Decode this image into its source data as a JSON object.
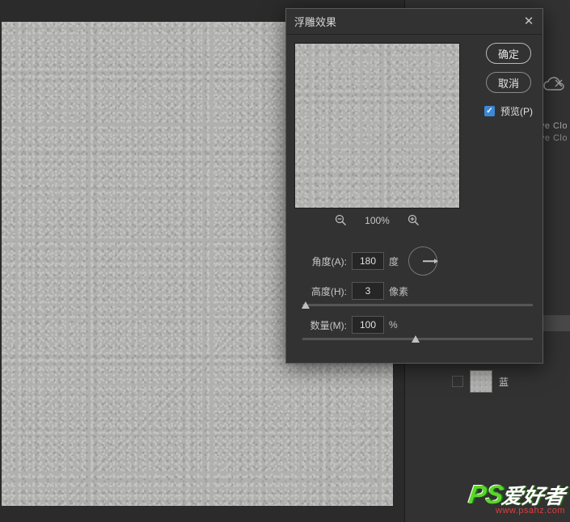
{
  "dialog": {
    "title": "浮雕效果",
    "ok_label": "确定",
    "cancel_label": "取消",
    "preview_label": "预览(P)",
    "preview_checked": true,
    "zoom_value": "100%",
    "controls": {
      "angle": {
        "label": "角度(A):",
        "value": "180",
        "unit": "度"
      },
      "height": {
        "label": "高度(H):",
        "value": "3",
        "unit": "像素",
        "slider_pos_pct": 1.5
      },
      "amount": {
        "label": "数量(M):",
        "value": "100",
        "unit": "%",
        "slider_pos_pct": 49
      }
    }
  },
  "right_panel": {
    "cloud_line1": "ve Clo",
    "cloud_line2": "ve Clo",
    "layer": {
      "name": "蓝"
    }
  },
  "watermark": {
    "ps": "PS",
    "ahz": "爱好者",
    "url": "www.psahz.com"
  },
  "icons": {
    "close": "close-icon",
    "zoom_out": "zoom-out-icon",
    "zoom_in": "zoom-in-icon",
    "cloud": "cloud-icon",
    "check": "checkmark-icon"
  }
}
